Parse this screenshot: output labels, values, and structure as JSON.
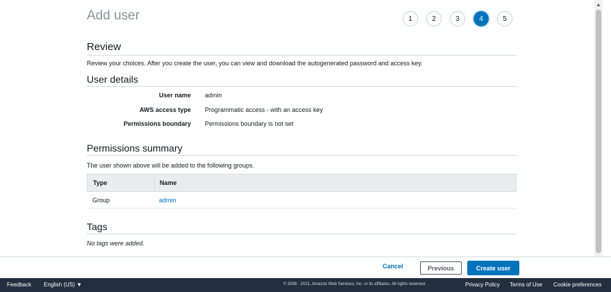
{
  "page": {
    "title": "Add user"
  },
  "steps": {
    "items": [
      "1",
      "2",
      "3",
      "4",
      "5"
    ],
    "active": "4",
    "accent": "#0073bb"
  },
  "review": {
    "title": "Review",
    "description": "Review your choices. After you create the user, you can view and download the autogenerated password and access key."
  },
  "user_details": {
    "title": "User details",
    "rows": [
      {
        "label": "User name",
        "value": "admin"
      },
      {
        "label": "AWS access type",
        "value": "Programmatic access - with an access key"
      },
      {
        "label": "Permissions boundary",
        "value": "Permissions boundary is not set"
      }
    ]
  },
  "permissions_summary": {
    "title": "Permissions summary",
    "description": "The user shown above will be added to the following groups.",
    "columns": [
      "Type",
      "Name"
    ],
    "rows": [
      {
        "type": "Group",
        "name": "admin"
      }
    ]
  },
  "tags": {
    "title": "Tags",
    "empty_text": "No tags were added."
  },
  "actions": {
    "cancel": "Cancel",
    "previous": "Previous",
    "create": "Create user"
  },
  "footer": {
    "feedback": "Feedback",
    "language": "English (US) ▼",
    "copyright": "© 2008 - 2021, Amazon Web Services, Inc. or its affiliates. All rights reserved.",
    "privacy": "Privacy Policy",
    "terms": "Terms of Use",
    "cookies": "Cookie preferences"
  }
}
